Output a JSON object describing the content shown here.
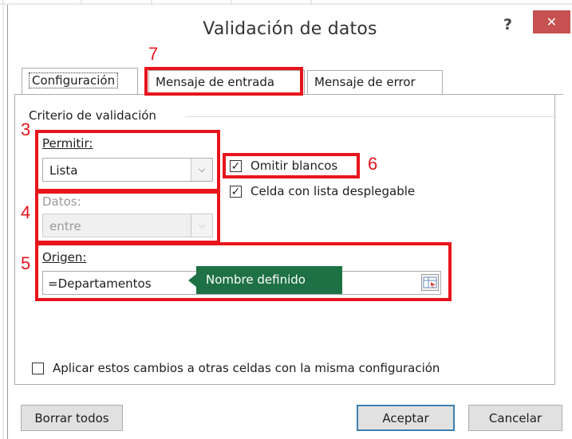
{
  "dialog": {
    "title": "Validación de datos",
    "help_label": "?",
    "close_label": "✕"
  },
  "tabs": [
    {
      "label": "Configuración",
      "active": true
    },
    {
      "label": "Mensaje de entrada",
      "active": false
    },
    {
      "label": "Mensaje de error",
      "active": false
    }
  ],
  "criteria": {
    "group_label": "Criterio de validación",
    "allow": {
      "label": "Permitir:",
      "value": "Lista"
    },
    "data": {
      "label": "Datos:",
      "value": "entre",
      "enabled": false
    },
    "source": {
      "label": "Origen:",
      "value": "=Departamentos",
      "tooltip": "Nombre definido"
    },
    "ignore_blank": {
      "label": "Omitir blancos",
      "checked": true
    },
    "in_cell_dropdown": {
      "label": "Celda con lista desplegable",
      "checked": true
    },
    "apply_all": {
      "label": "Aplicar estos cambios a otras celdas con la misma configuración",
      "checked": false
    }
  },
  "buttons": {
    "clear_all": "Borrar todos",
    "ok": "Aceptar",
    "cancel": "Cancelar"
  },
  "annotations": [
    "3",
    "4",
    "5",
    "6",
    "7"
  ],
  "colors": {
    "annotation": "#e8141b",
    "tooltip_bg": "#1e7145",
    "close_bg": "#c75050"
  }
}
